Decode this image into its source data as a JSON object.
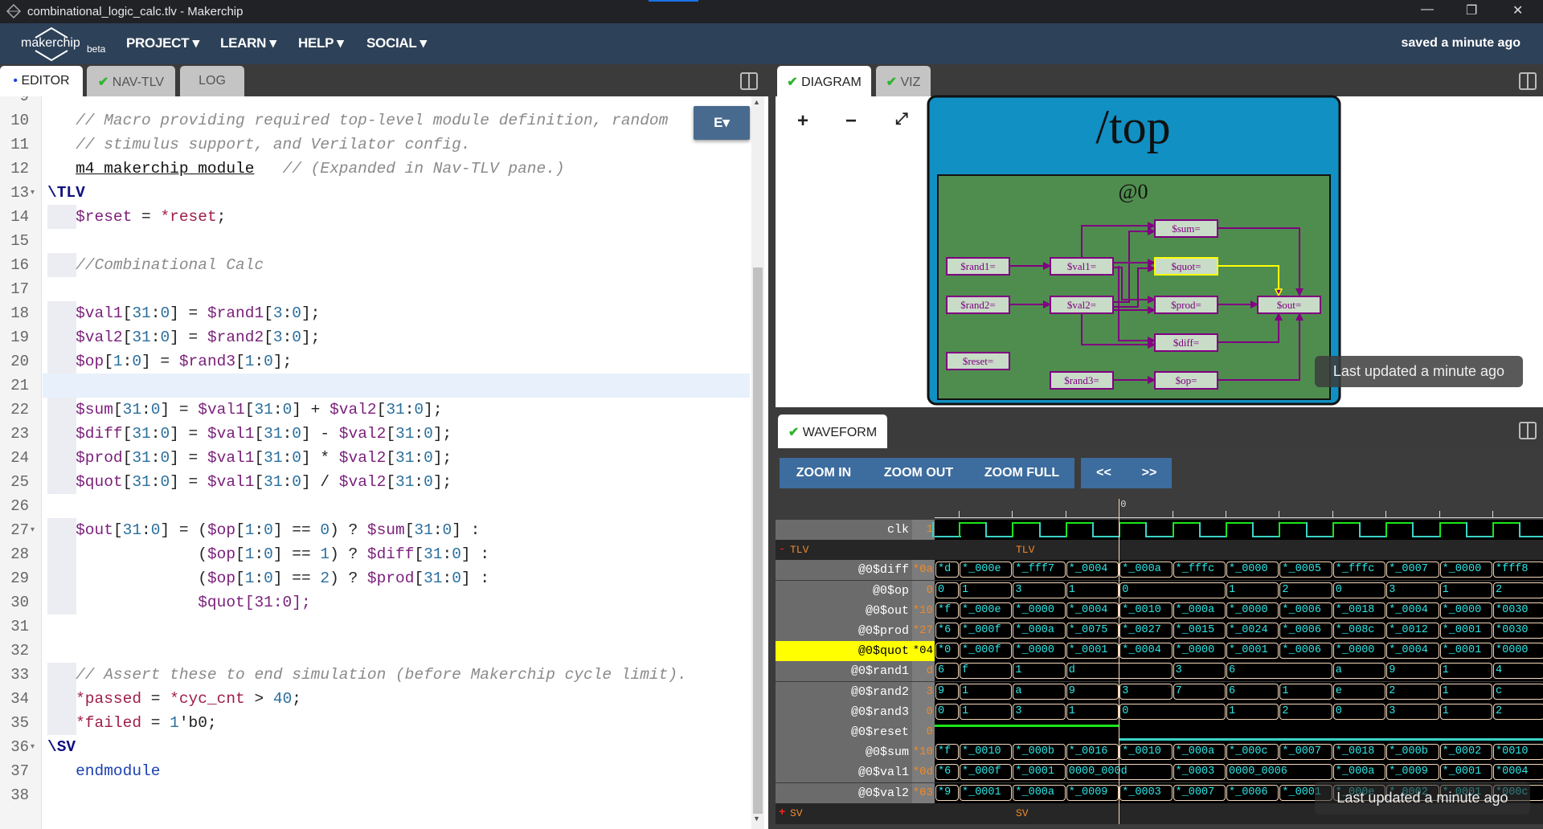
{
  "window": {
    "title": "combinational_logic_calc.tlv - Makerchip",
    "controls": [
      "—",
      "❐",
      "✕"
    ]
  },
  "nav": {
    "logo": "makerchip",
    "logo_sub": "beta",
    "items": [
      "PROJECT ▾",
      "LEARN ▾",
      "HELP ▾",
      "SOCIAL ▾"
    ],
    "status": "saved a minute ago"
  },
  "left_tabs": [
    {
      "label": "EDITOR",
      "marker": "•"
    },
    {
      "label": "NAV-TLV",
      "check": "✔"
    },
    {
      "label": "LOG"
    }
  ],
  "editor": {
    "mode_button": "E▾",
    "first_line": 9,
    "current_line": 21,
    "fold_lines": [
      13,
      27,
      36
    ],
    "guide_lines": [
      14,
      16,
      18,
      19,
      20,
      22,
      23,
      24,
      25,
      27,
      28,
      29,
      30,
      33,
      34,
      35
    ],
    "lines": [
      "",
      "   // Macro providing required top-level module definition, random",
      "   // stimulus support, and Verilator config.",
      "   m4_makerchip_module   // (Expanded in Nav-TLV pane.)",
      "\\TLV",
      "   $reset = *reset;",
      "",
      "   //Combinational Calc",
      "",
      "   $val1[31:0] = $rand1[3:0];",
      "   $val2[31:0] = $rand2[3:0];",
      "   $op[1:0] = $rand3[1:0];",
      "",
      "   $sum[31:0] = $val1[31:0] + $val2[31:0];",
      "   $diff[31:0] = $val1[31:0] - $val2[31:0];",
      "   $prod[31:0] = $val1[31:0] * $val2[31:0];",
      "   $quot[31:0] = $val1[31:0] / $val2[31:0];",
      "",
      "   $out[31:0] = ($op[1:0] == 0) ? $sum[31:0] :",
      "                ($op[1:0] == 1) ? $diff[31:0] :",
      "                ($op[1:0] == 2) ? $prod[31:0] :",
      "                $quot[31:0];",
      "",
      "",
      "   // Assert these to end simulation (before Makerchip cycle limit).",
      "   *passed = *cyc_cnt > 40;",
      "   *failed = 1'b0;",
      "\\SV",
      "   endmodule",
      ""
    ]
  },
  "right_tabs": [
    {
      "label": "DIAGRAM",
      "check": "✔"
    },
    {
      "label": "VIZ",
      "check": "✔"
    }
  ],
  "diagram": {
    "zoom_in": "+",
    "zoom_out": "−",
    "fit": "⤢",
    "title": "/top",
    "stage": "@0",
    "nodes": {
      "rand1": "$rand1=",
      "rand2": "$rand2=",
      "rand3": "$rand3=",
      "reset": "$reset=",
      "val1": "$val1=",
      "val2": "$val2=",
      "sum": "$sum=",
      "quot": "$quot=",
      "prod": "$prod=",
      "diff": "$diff=",
      "op": "$op=",
      "out": "$out="
    },
    "highlighted": "quot",
    "colors": {
      "outer": "#1190c3",
      "inner": "#4f8d4f",
      "node": "#c8dcc8",
      "edge": "#800080",
      "highlight": "#ffff00"
    },
    "toast": "Last updated a minute ago"
  },
  "waveform": {
    "tab": "WAVEFORM",
    "check": "✔",
    "buttons": [
      "ZOOM IN",
      "ZOOM OUT",
      "ZOOM FULL"
    ],
    "nav_buttons": [
      "<<",
      ">>"
    ],
    "cursor_label": "0",
    "toast": "Last updated a minute ago",
    "clk": {
      "name": "clk",
      "value": "1"
    },
    "groups": {
      "tlv": {
        "toggle": "-",
        "name": "TLV"
      },
      "sv": {
        "toggle": "+",
        "name": "SV"
      }
    },
    "highlighted": "@0$quot",
    "signals": [
      {
        "name": "@0$diff",
        "value": "*0a",
        "cells": [
          [
            "*d",
            1
          ],
          [
            "*_000e",
            1
          ],
          [
            "*_fff7",
            1
          ],
          [
            "*_0004",
            1
          ],
          [
            "*_000a",
            1
          ],
          [
            "*_fffc",
            1
          ],
          [
            "*_0000",
            1
          ],
          [
            "*_0005",
            1
          ],
          [
            "*_fffc",
            1
          ],
          [
            "*_0007",
            1
          ],
          [
            "*_0000",
            1
          ],
          [
            "*fff8",
            1
          ]
        ]
      },
      {
        "name": "@0$op",
        "value": "0",
        "cells": [
          [
            "0",
            1
          ],
          [
            "1",
            1
          ],
          [
            "3",
            1
          ],
          [
            "1",
            1
          ],
          [
            "0",
            2
          ],
          [
            "1",
            1
          ],
          [
            "2",
            1
          ],
          [
            "0",
            1
          ],
          [
            "3",
            1
          ],
          [
            "1",
            1
          ],
          [
            "2",
            1
          ]
        ]
      },
      {
        "name": "@0$out",
        "value": "*10",
        "cells": [
          [
            "*f",
            1
          ],
          [
            "*_000e",
            1
          ],
          [
            "*_0000",
            1
          ],
          [
            "*_0004",
            1
          ],
          [
            "*_0010",
            1
          ],
          [
            "*_000a",
            1
          ],
          [
            "*_0000",
            1
          ],
          [
            "*_0006",
            1
          ],
          [
            "*_0018",
            1
          ],
          [
            "*_0004",
            1
          ],
          [
            "*_0000",
            1
          ],
          [
            "*0030",
            1
          ]
        ]
      },
      {
        "name": "@0$prod",
        "value": "*27",
        "cells": [
          [
            "*6",
            1
          ],
          [
            "*_000f",
            1
          ],
          [
            "*_000a",
            1
          ],
          [
            "*_0075",
            1
          ],
          [
            "*_0027",
            1
          ],
          [
            "*_0015",
            1
          ],
          [
            "*_0024",
            1
          ],
          [
            "*_0006",
            1
          ],
          [
            "*_008c",
            1
          ],
          [
            "*_0012",
            1
          ],
          [
            "*_0001",
            1
          ],
          [
            "*0030",
            1
          ]
        ]
      },
      {
        "name": "@0$quot",
        "value": "*04",
        "cells": [
          [
            "*0",
            1
          ],
          [
            "*_000f",
            1
          ],
          [
            "*_0000",
            1
          ],
          [
            "*_0001",
            1
          ],
          [
            "*_0004",
            1
          ],
          [
            "*_0000",
            1
          ],
          [
            "*_0001",
            1
          ],
          [
            "*_0006",
            1
          ],
          [
            "*_0000",
            1
          ],
          [
            "*_0004",
            1
          ],
          [
            "*_0001",
            1
          ],
          [
            "*0000",
            1
          ]
        ]
      },
      {
        "name": "@0$rand1",
        "value": "d",
        "cells": [
          [
            "6",
            1
          ],
          [
            "f",
            1
          ],
          [
            "1",
            1
          ],
          [
            "d",
            2
          ],
          [
            "3",
            1
          ],
          [
            "6",
            2
          ],
          [
            "a",
            1
          ],
          [
            "9",
            1
          ],
          [
            "1",
            1
          ],
          [
            "4",
            1
          ]
        ]
      },
      {
        "name": "@0$rand2",
        "value": "3",
        "cells": [
          [
            "9",
            1
          ],
          [
            "1",
            1
          ],
          [
            "a",
            1
          ],
          [
            "9",
            1
          ],
          [
            "3",
            1
          ],
          [
            "7",
            1
          ],
          [
            "6",
            1
          ],
          [
            "1",
            1
          ],
          [
            "e",
            1
          ],
          [
            "2",
            1
          ],
          [
            "1",
            1
          ],
          [
            "c",
            1
          ]
        ]
      },
      {
        "name": "@0$rand3",
        "value": "0",
        "cells": [
          [
            "0",
            1
          ],
          [
            "1",
            1
          ],
          [
            "3",
            1
          ],
          [
            "1",
            1
          ],
          [
            "0",
            2
          ],
          [
            "1",
            1
          ],
          [
            "2",
            1
          ],
          [
            "0",
            1
          ],
          [
            "3",
            1
          ],
          [
            "1",
            1
          ],
          [
            "2",
            1
          ]
        ]
      },
      {
        "name": "@0$reset",
        "value": "0",
        "bits": [
          1,
          1,
          1,
          1,
          0,
          0,
          0,
          0,
          0,
          0,
          0,
          0
        ]
      },
      {
        "name": "@0$sum",
        "value": "*10",
        "cells": [
          [
            "*f",
            1
          ],
          [
            "*_0010",
            1
          ],
          [
            "*_000b",
            1
          ],
          [
            "*_0016",
            1
          ],
          [
            "*_0010",
            1
          ],
          [
            "*_000a",
            1
          ],
          [
            "*_000c",
            1
          ],
          [
            "*_0007",
            1
          ],
          [
            "*_0018",
            1
          ],
          [
            "*_000b",
            1
          ],
          [
            "*_0002",
            1
          ],
          [
            "*0010",
            1
          ]
        ]
      },
      {
        "name": "@0$val1",
        "value": "*0d",
        "cells": [
          [
            "*6",
            1
          ],
          [
            "*_000f",
            1
          ],
          [
            "*_0001",
            1
          ],
          [
            "0000_000d",
            2
          ],
          [
            "*_0003",
            1
          ],
          [
            "0000_0006",
            2
          ],
          [
            "*_000a",
            1
          ],
          [
            "*_0009",
            1
          ],
          [
            "*_0001",
            1
          ],
          [
            "*0004",
            1
          ]
        ]
      },
      {
        "name": "@0$val2",
        "value": "*03",
        "cells": [
          [
            "*9",
            1
          ],
          [
            "*_0001",
            1
          ],
          [
            "*_000a",
            1
          ],
          [
            "*_0009",
            1
          ],
          [
            "*_0003",
            1
          ],
          [
            "*_0007",
            1
          ],
          [
            "*_0006",
            1
          ],
          [
            "*_0001",
            1
          ],
          [
            "*_000e",
            1
          ],
          [
            "*_0002",
            1
          ],
          [
            "*_0001",
            1
          ],
          [
            "*000c",
            1
          ]
        ]
      }
    ]
  }
}
